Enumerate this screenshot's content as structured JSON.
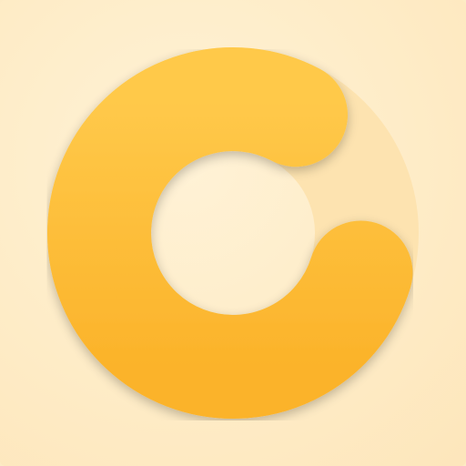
{
  "icon": {
    "name": "circular-loader-icon",
    "progress": 0.78
  },
  "colors": {
    "background": "#fdebc5",
    "track": "#fde3b0",
    "arc_light": "#ffc94a",
    "arc_dark": "#fbb32a"
  }
}
